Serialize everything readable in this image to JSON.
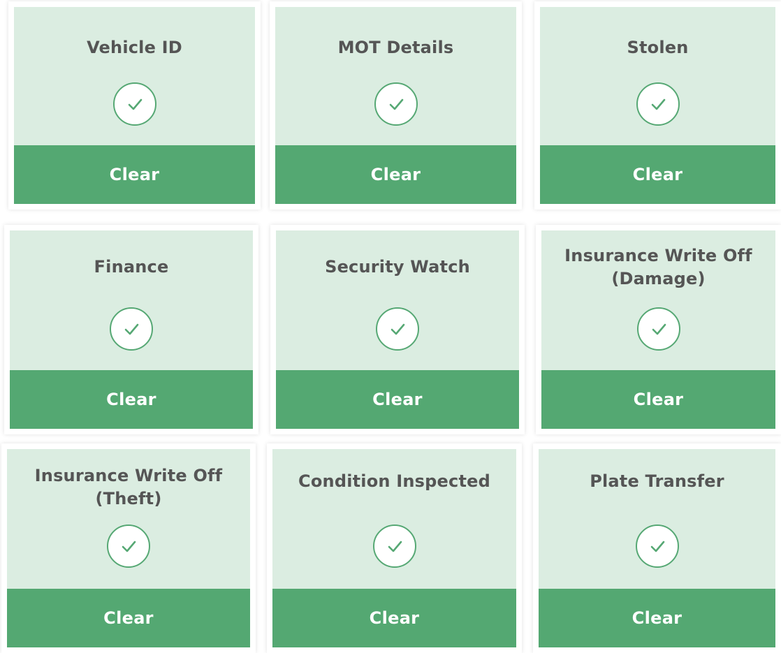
{
  "colors": {
    "card_top_bg": "#dbede1",
    "status_bar_bg": "#54a872",
    "check_ring": "#56a874",
    "title_text": "#555555",
    "status_text": "#ffffff"
  },
  "checks": [
    {
      "title": "Vehicle ID",
      "status": "Clear",
      "icon": "check-circle-icon"
    },
    {
      "title": "MOT Details",
      "status": "Clear",
      "icon": "check-circle-icon"
    },
    {
      "title": "Stolen",
      "status": "Clear",
      "icon": "check-circle-icon"
    },
    {
      "title": "Finance",
      "status": "Clear",
      "icon": "check-circle-icon"
    },
    {
      "title": "Security Watch",
      "status": "Clear",
      "icon": "check-circle-icon"
    },
    {
      "title": "Insurance Write Off\n(Damage)",
      "status": "Clear",
      "icon": "check-circle-icon"
    },
    {
      "title": "Insurance Write Off\n(Theft)",
      "status": "Clear",
      "icon": "check-circle-icon"
    },
    {
      "title": "Condition Inspected",
      "status": "Clear",
      "icon": "check-circle-icon"
    },
    {
      "title": "Plate Transfer",
      "status": "Clear",
      "icon": "check-circle-icon"
    }
  ]
}
